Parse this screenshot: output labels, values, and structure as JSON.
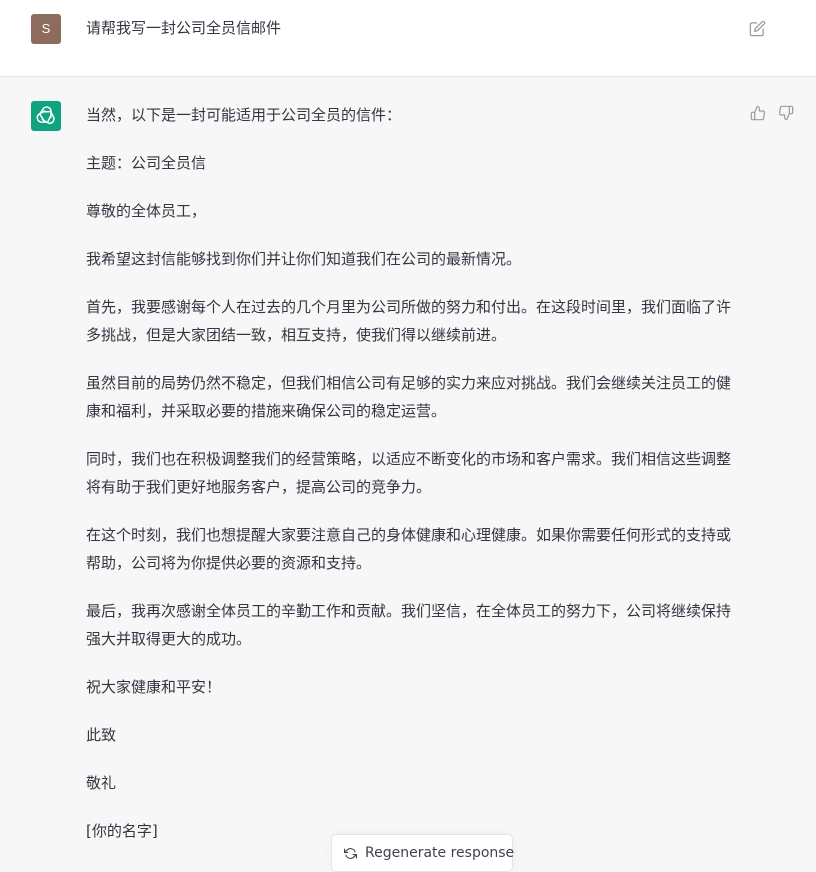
{
  "user_message": {
    "avatar_initial": "S",
    "text": "请帮我写一封公司全员信邮件"
  },
  "assistant_message": {
    "paragraphs": [
      "当然，以下是一封可能适用于公司全员的信件：",
      "主题：公司全员信",
      "尊敬的全体员工，",
      "我希望这封信能够找到你们并让你们知道我们在公司的最新情况。",
      "首先，我要感谢每个人在过去的几个月里为公司所做的努力和付出。在这段时间里，我们面临了许多挑战，但是大家团结一致，相互支持，使我们得以继续前进。",
      "虽然目前的局势仍然不稳定，但我们相信公司有足够的实力来应对挑战。我们会继续关注员工的健康和福利，并采取必要的措施来确保公司的稳定运营。",
      "同时，我们也在积极调整我们的经营策略，以适应不断变化的市场和客户需求。我们相信这些调整将有助于我们更好地服务客户，提高公司的竞争力。",
      "在这个时刻，我们也想提醒大家要注意自己的身体健康和心理健康。如果你需要任何形式的支持或帮助，公司将为你提供必要的资源和支持。",
      "最后，我再次感谢全体员工的辛勤工作和贡献。我们坚信，在全体员工的努力下，公司将继续保持强大并取得更大的成功。",
      "祝大家健康和平安！",
      "此致",
      "敬礼",
      "[你的名字]"
    ]
  },
  "regenerate_button": {
    "label": "Regenerate response"
  },
  "icons": {
    "edit": "edit-icon",
    "thumbs_up": "thumbs-up-icon",
    "thumbs_down": "thumbs-down-icon",
    "assistant_logo": "openai-logo-icon",
    "regenerate": "refresh-icon"
  },
  "colors": {
    "user_avatar": "#8e6c5d",
    "assistant_avatar": "#10a37f",
    "assistant_background": "#f7f7f8",
    "text": "#343541"
  }
}
